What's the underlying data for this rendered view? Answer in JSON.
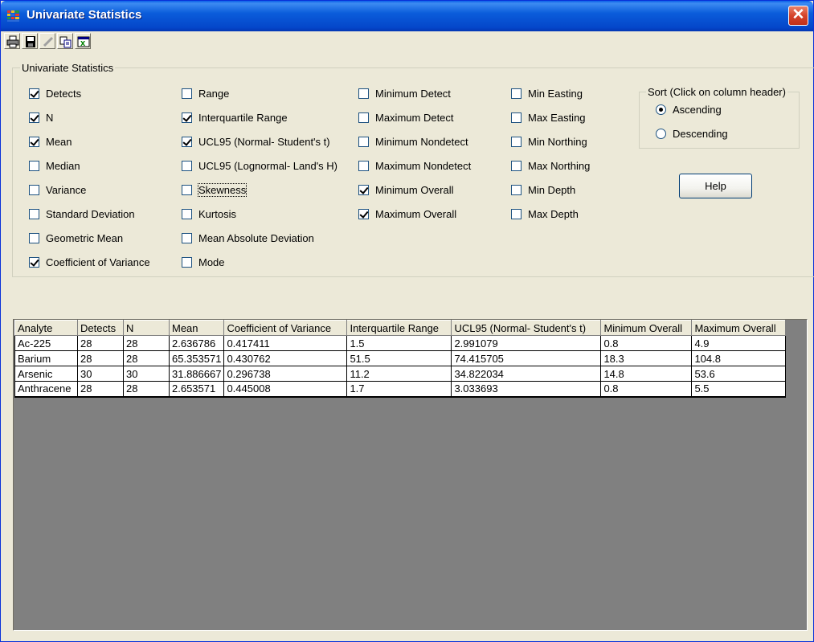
{
  "window": {
    "title": "Univariate Statistics",
    "close_label": "✕"
  },
  "toolbar": {
    "icons": [
      "printer-icon",
      "save-icon",
      "edit-icon",
      "copy-icon",
      "excel-icon"
    ]
  },
  "stats_group": {
    "legend": "Univariate Statistics",
    "column1": [
      {
        "label": "Detects",
        "checked": true
      },
      {
        "label": "N",
        "checked": true
      },
      {
        "label": "Mean",
        "checked": true
      },
      {
        "label": "Median",
        "checked": false
      },
      {
        "label": "Variance",
        "checked": false
      },
      {
        "label": "Standard Deviation",
        "checked": false
      },
      {
        "label": "Geometric Mean",
        "checked": false
      },
      {
        "label": "Coefficient of Variance",
        "checked": true
      }
    ],
    "column2": [
      {
        "label": "Range",
        "checked": false
      },
      {
        "label": "Interquartile Range",
        "checked": true
      },
      {
        "label": "UCL95 (Normal- Student's t)",
        "checked": true
      },
      {
        "label": "UCL95 (Lognormal- Land's H)",
        "checked": false
      },
      {
        "label": "Skewness",
        "checked": false
      },
      {
        "label": "Kurtosis",
        "checked": false
      },
      {
        "label": "Mean Absolute Deviation",
        "checked": false
      },
      {
        "label": "Mode",
        "checked": false
      }
    ],
    "column3": [
      {
        "label": "Minimum Detect",
        "checked": false
      },
      {
        "label": "Maximum Detect",
        "checked": false
      },
      {
        "label": "Minimum Nondetect",
        "checked": false
      },
      {
        "label": "Maximum Nondetect",
        "checked": false
      },
      {
        "label": "Minimum Overall",
        "checked": true
      },
      {
        "label": "Maximum Overall",
        "checked": true
      }
    ],
    "column4": [
      {
        "label": "Min Easting",
        "checked": false
      },
      {
        "label": "Max Easting",
        "checked": false
      },
      {
        "label": "Min Northing",
        "checked": false
      },
      {
        "label": "Max Northing",
        "checked": false
      },
      {
        "label": "Min Depth",
        "checked": false
      },
      {
        "label": "Max Depth",
        "checked": false
      }
    ]
  },
  "sort_group": {
    "legend": "Sort (Click on column header)",
    "ascending_label": "Ascending",
    "descending_label": "Descending",
    "selected": "Ascending"
  },
  "help_button": {
    "label": "Help"
  },
  "results_table": {
    "columns": [
      "Analyte",
      "Detects",
      "N",
      "Mean",
      "Coefficient of Variance",
      "Interquartile Range",
      "UCL95 (Normal- Student's t)",
      "Minimum Overall",
      "Maximum Overall"
    ],
    "rows": [
      [
        "Ac-225",
        "28",
        "28",
        "2.636786",
        "0.417411",
        "1.5",
        "2.991079",
        "0.8",
        "4.9"
      ],
      [
        "Barium",
        "28",
        "28",
        "65.353571",
        "0.430762",
        "51.5",
        "74.415705",
        "18.3",
        "104.8"
      ],
      [
        "Arsenic",
        "30",
        "30",
        "31.886667",
        "0.296738",
        "11.2",
        "34.822034",
        "14.8",
        "53.6"
      ],
      [
        "Anthracene",
        "28",
        "28",
        "2.653571",
        "0.445008",
        "1.7",
        "3.033693",
        "0.8",
        "5.5"
      ]
    ]
  }
}
